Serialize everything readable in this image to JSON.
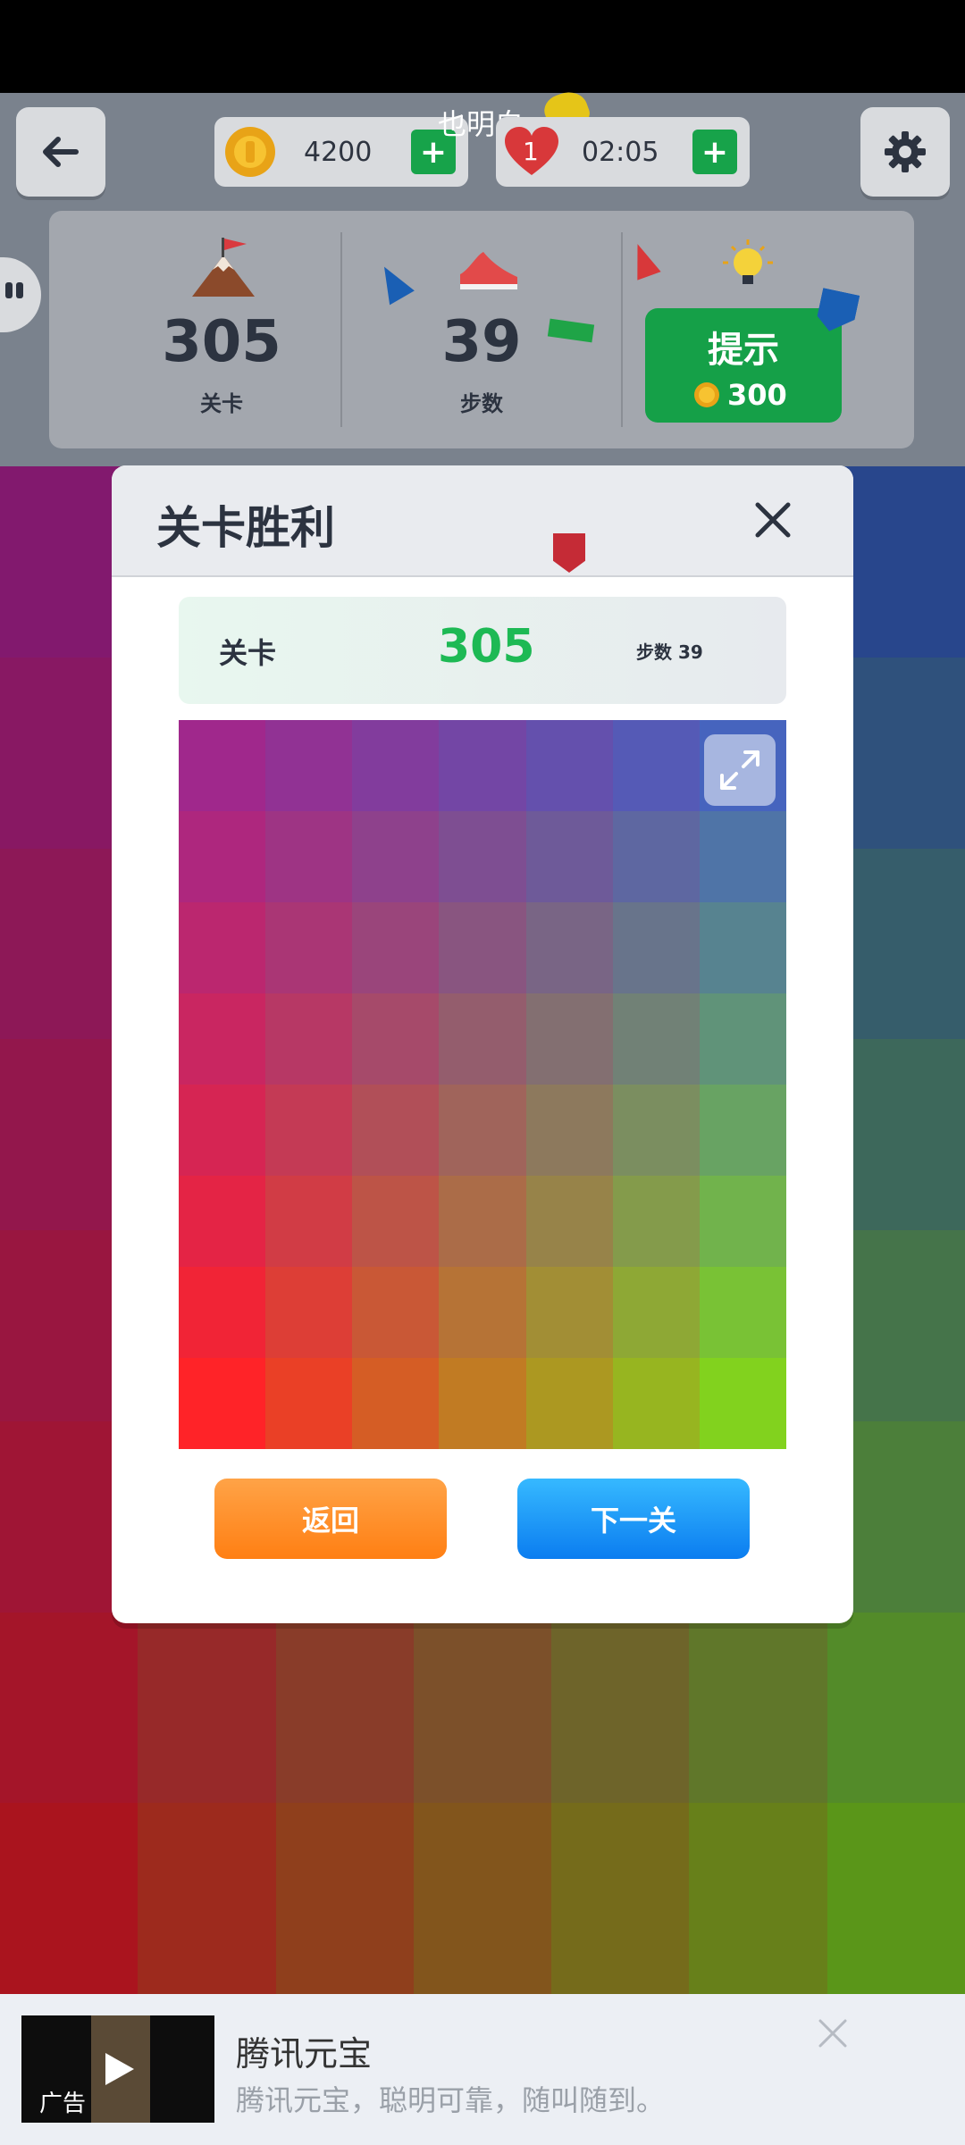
{
  "top_bar": {
    "overlay_text": "也明白",
    "coins": "4200",
    "timer": "02:05",
    "lives": "1"
  },
  "stats": {
    "level_value": "305",
    "level_label": "关卡",
    "steps_value": "39",
    "steps_label": "步数",
    "hint_label": "提示",
    "hint_cost": "300"
  },
  "modal": {
    "title": "关卡胜利",
    "level_label": "关卡",
    "level_value": "305",
    "steps_text": "步数 39",
    "back_label": "返回",
    "next_label": "下一关"
  },
  "ad": {
    "badge": "广告",
    "title": "腾讯元宝",
    "subtitle": "腾讯元宝，聪明可靠，随叫随到。"
  },
  "colors": {
    "accent_green": "#15a048",
    "level_green": "#1db954",
    "back_orange": "#ff8a1f",
    "next_blue": "#1e8cf5"
  }
}
